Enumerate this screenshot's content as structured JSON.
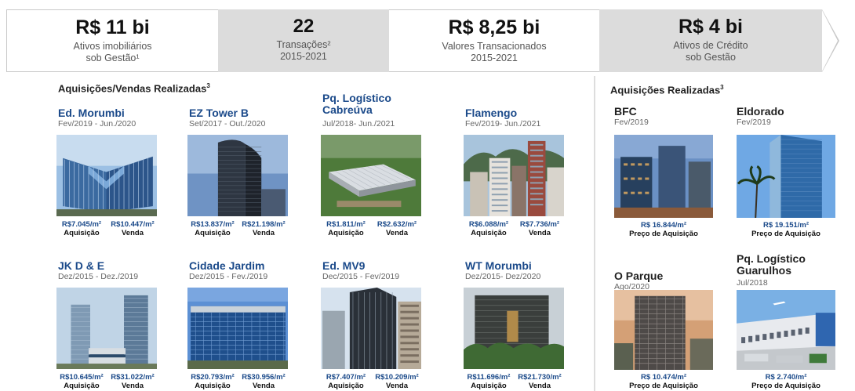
{
  "kpis": [
    {
      "value": "R$ 11 bi",
      "label": "Ativos imobiliários\nsob Gestão¹"
    },
    {
      "value": "22",
      "label": "Transações²\n2015-2021"
    },
    {
      "value": "R$ 8,25 bi",
      "label": "Valores Transacionados\n2015-2021"
    },
    {
      "value": "R$ 4 bi",
      "label": "Ativos de Crédito\nsob Gestão"
    }
  ],
  "left_section": {
    "title": "Aquisições/Vendas Realizadas",
    "title_sup": "3",
    "price_unit": "/m²",
    "acq_label": "Aquisição",
    "sale_label": "Venda",
    "properties": [
      {
        "name": "Ed. Morumbi",
        "dates": "Fev/2019 - Jun./2020",
        "acq": "R$7.045",
        "sale": "R$10.447"
      },
      {
        "name": "EZ Tower B",
        "dates": "Set/2017 - Out./2020",
        "acq": "R$13.837",
        "sale": "R$21.198"
      },
      {
        "name": "Pq. Logístico\nCabreúva",
        "dates": "Jul/2018- Jun./2021",
        "acq": "R$1.811",
        "sale": "R$2.632"
      },
      {
        "name": "Flamengo",
        "dates": "Fev/2019- Jun./2021",
        "acq": "R$6.088",
        "sale": "R$7.736"
      },
      {
        "name": "JK D & E",
        "dates": "Dez/2015 - Dez./2019",
        "acq": "R$10.645",
        "sale": "R$31.022"
      },
      {
        "name": "Cidade Jardim",
        "dates": "Dez/2015 - Fev./2019",
        "acq": "R$20.793",
        "sale": "R$30.956"
      },
      {
        "name": "Ed. MV9",
        "dates": "Dec/2015 - Fev/2019",
        "acq": "R$7.407",
        "sale": "R$10.209"
      },
      {
        "name": "WT Morumbi",
        "dates": "Dez/2015- Dez/2020",
        "acq": "R$11.696",
        "sale": "R$21.730"
      }
    ]
  },
  "right_section": {
    "title": "Aquisições Realizadas",
    "title_sup": "3",
    "price_label": "Preço de Aquisição",
    "price_unit": "/m²",
    "properties": [
      {
        "name": "BFC",
        "dates": "Fev/2019",
        "price": "R$ 16.844"
      },
      {
        "name": "Eldorado",
        "dates": "Fev/2019",
        "price": "R$ 19.151"
      },
      {
        "name": "O Parque",
        "dates": "Ago/2020",
        "price": "R$ 10.474"
      },
      {
        "name": "Pq. Logístico\nGuarulhos",
        "dates": "Jul/2018",
        "price": "R$ 2.740"
      }
    ]
  }
}
